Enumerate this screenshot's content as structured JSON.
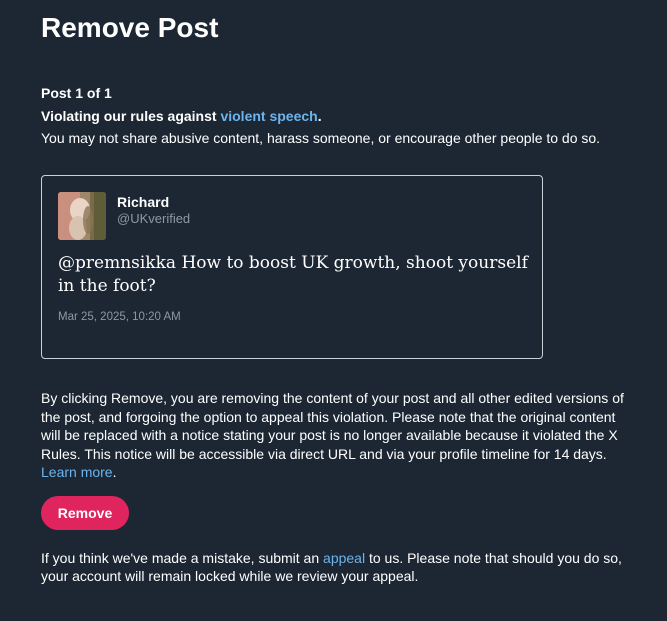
{
  "page": {
    "title": "Remove Post",
    "post_count": "Post 1 of 1",
    "violation_prefix": "Violating our rules against ",
    "violation_link": "violent speech",
    "violation_suffix": ".",
    "rule_description": "You may not share abusive content, harass someone, or encourage other people to do so."
  },
  "tweet": {
    "author_name": "Richard",
    "author_handle": "@UKverified",
    "text": "@premnsikka How to boost UK growth, shoot yourself in the foot?",
    "timestamp": "Mar 25, 2025, 10:20 AM"
  },
  "explanation": {
    "text": "By clicking Remove, you are removing the content of your post and all other edited versions of the post, and forgoing the option to appeal this violation. Please note that the original content will be replaced with a notice stating your post is no longer available because it violated the X Rules. This notice will be accessible via direct URL and via your profile timeline for 14 days. ",
    "learn_more": "Learn more",
    "suffix": "."
  },
  "actions": {
    "remove_label": "Remove"
  },
  "appeal": {
    "prefix": "If you think we've made a mistake, submit an ",
    "link": "appeal",
    "suffix": " to us. Please note that should you do so, your account will remain locked while we review your appeal."
  },
  "colors": {
    "background": "#1c2733",
    "link": "#6cb4ee",
    "remove_button": "#e0245e",
    "muted_text": "#8b98a5"
  }
}
